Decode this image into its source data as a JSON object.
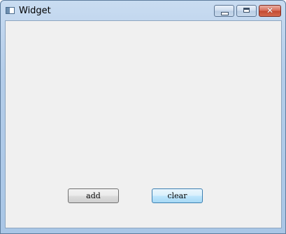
{
  "window": {
    "title": "Widget",
    "close_glyph": "✕"
  },
  "buttons": {
    "add_label": "add",
    "clear_label": "clear"
  },
  "icons": {
    "app": "window-app-icon",
    "minimize": "minimize-icon",
    "maximize": "maximize-icon",
    "close": "close-icon"
  },
  "colors": {
    "client_background": "#f0f0f0",
    "title_bar": "#b4cde9",
    "close_button": "#c44a32",
    "focused_button": "#bee6fd"
  }
}
